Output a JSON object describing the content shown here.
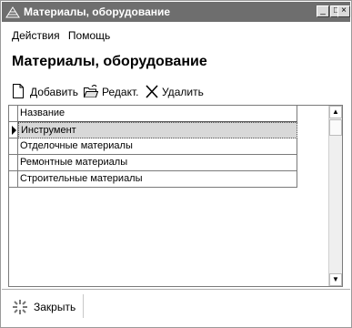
{
  "window": {
    "title": "Материалы, оборудование"
  },
  "menu": {
    "items": [
      "Действия",
      "Помощь"
    ]
  },
  "heading": "Материалы, оборудование",
  "toolbar": {
    "add": "Добавить",
    "edit": "Редакт.",
    "delete": "Удалить"
  },
  "grid": {
    "column": "Название",
    "rows": [
      "Инструмент",
      "Отделочные материалы",
      "Ремонтные материалы",
      "Строительные материалы"
    ],
    "selected_index": 0
  },
  "footer": {
    "close": "Закрыть"
  }
}
